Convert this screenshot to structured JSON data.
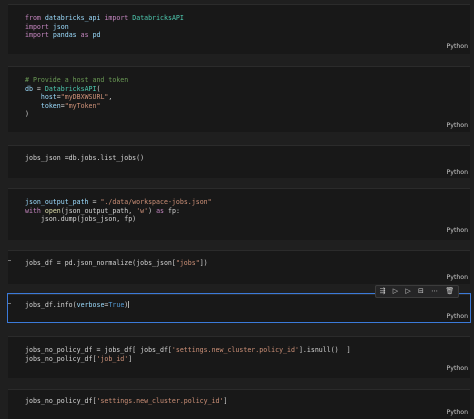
{
  "cells": [
    {
      "lang": "Python"
    },
    {
      "lang": "Python"
    },
    {
      "lang": "Python"
    },
    {
      "lang": "Python"
    },
    {
      "lang": "Python"
    },
    {
      "lang": "Python"
    },
    {
      "lang": "Python"
    },
    {
      "lang": "Python"
    }
  ],
  "code": {
    "c1": {
      "l1_from": "from",
      "l1_mod": "databricks_api",
      "l1_import": "import",
      "l1_cls": "DatabricksAPI",
      "l2_import": "import",
      "l2_mod": "json",
      "l3_import": "import",
      "l3_mod": "pandas",
      "l3_as": "as",
      "l3_alias": "pd"
    },
    "c2": {
      "comment": "# Provide a host and token",
      "l2_var": "db",
      "l2_eq": " = ",
      "l2_cls": "DatabricksAPI",
      "l2_paren": "(",
      "l3_kw": "host",
      "l3_eq": "=",
      "l3_str": "\"myDBXWSURL\"",
      "l3_end": ",",
      "l4_kw": "token",
      "l4_eq": "=",
      "l4_str": "\"myToken\"",
      "l5": ")"
    },
    "c3": {
      "text": "jobs_json =db.jobs.list_jobs()"
    },
    "c4": {
      "l1_var": "json_output_path",
      "l1_eq": " = ",
      "l1_str": "\"./data/workspace-jobs.json\"",
      "l2_with": "with",
      "l2_open": "open",
      "l2_args": "(json_output_path, ",
      "l2_mode": "'w'",
      "l2_close": ") ",
      "l2_as": "as",
      "l2_fp": " fp:",
      "l3": "    json.dump(jobs_json, fp)"
    },
    "c5": {
      "pre": "jobs_df = pd.json_normalize(jobs_json[",
      "str": "\"jobs\"",
      "post": "])"
    },
    "c6": {
      "pre": "jobs_df.info",
      "paren": "(",
      "kw": "verbose",
      "eq": "=",
      "val": "True",
      "close": ")"
    },
    "c7": {
      "l1_pre": "jobs_no_policy_df = jobs_df[ jobs_df[",
      "l1_str": "'settings.new_cluster.policy_id'",
      "l1_post": "].isnull()  ]",
      "l2_pre": "jobs_no_policy_df[",
      "l2_str": "'job_id'",
      "l2_post": "]"
    },
    "c8": {
      "pre": "jobs_no_policy_df[",
      "str": "'settings.new_cluster.policy_id'",
      "post": "]"
    }
  },
  "toolbar_icons": [
    "run-by-line-icon",
    "execute-above-icon",
    "execute-below-icon",
    "split-cell-icon",
    "more-icon",
    "delete-icon"
  ]
}
